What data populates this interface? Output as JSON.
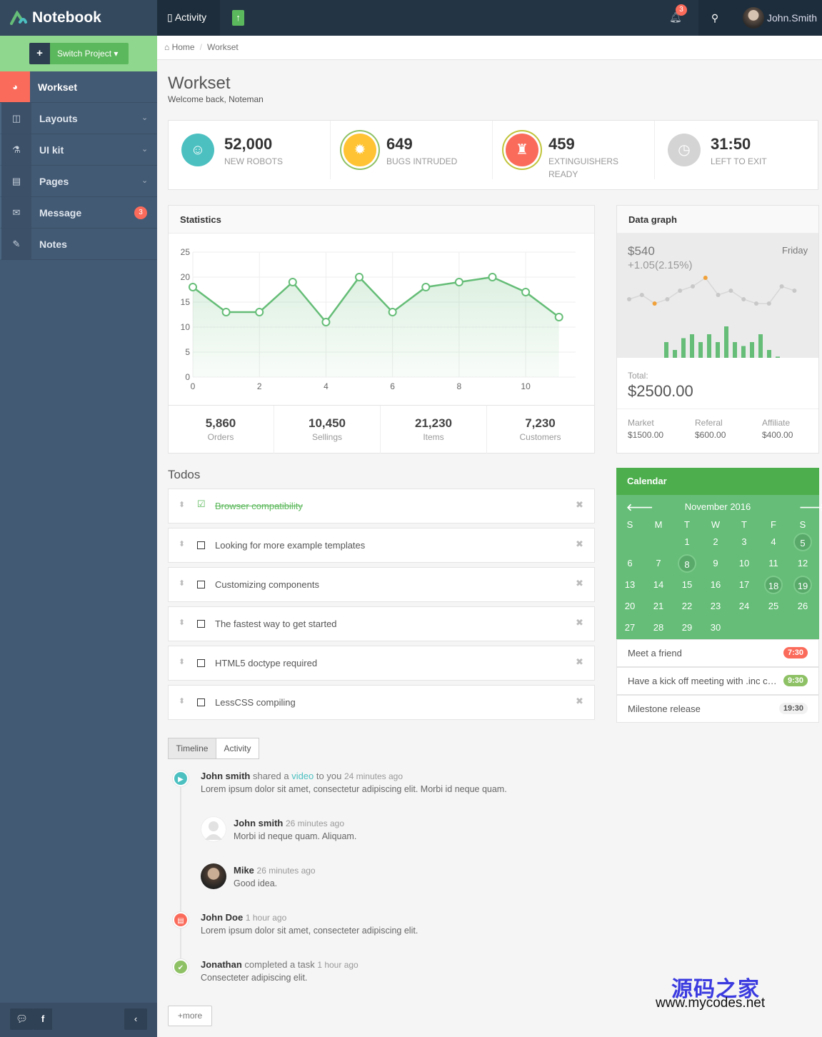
{
  "brand": {
    "name": "Notebook"
  },
  "header": {
    "activity_label": "Activity",
    "notifications_count": "3",
    "username": "John.Smith"
  },
  "sidebar": {
    "switch_project_label": "Switch Project ▾",
    "items": [
      {
        "label": "Workset",
        "icon": "dashboard-icon",
        "active": true
      },
      {
        "label": "Layouts",
        "icon": "columns-icon"
      },
      {
        "label": "UI kit",
        "icon": "flask-icon"
      },
      {
        "label": "Pages",
        "icon": "file-icon"
      },
      {
        "label": "Message",
        "icon": "envelope-icon",
        "badge": "3"
      },
      {
        "label": "Notes",
        "icon": "pencil-icon"
      }
    ]
  },
  "breadcrumb": {
    "home": "Home",
    "current": "Workset"
  },
  "page": {
    "title": "Workset",
    "subtitle": "Welcome back, Noteman"
  },
  "stats": [
    {
      "value": "52,000",
      "label": "NEW ROBOTS",
      "color": "#4cc0c1",
      "icon": "robot-icon"
    },
    {
      "value": "649",
      "label": "BUGS INTRUDED",
      "color": "#ffc333",
      "icon": "bug-icon"
    },
    {
      "value": "459",
      "label": "EXTINGUISHERS READY",
      "color": "#fb6b5b",
      "icon": "extinguisher-icon"
    },
    {
      "value": "31:50",
      "label": "LEFT TO EXIT",
      "color": "#d4d4d4",
      "icon": "clock-icon"
    }
  ],
  "statistics": {
    "title": "Statistics",
    "footer": [
      {
        "value": "5,860",
        "label": "Orders"
      },
      {
        "value": "10,450",
        "label": "Sellings"
      },
      {
        "value": "21,230",
        "label": "Items"
      },
      {
        "value": "7,230",
        "label": "Customers"
      }
    ]
  },
  "chart_data": {
    "type": "area",
    "x": [
      0,
      1,
      2,
      3,
      4,
      5,
      6,
      7,
      8,
      9,
      10,
      11
    ],
    "values": [
      18,
      13,
      13,
      19,
      11,
      20,
      13,
      18,
      19,
      20,
      17,
      12
    ],
    "xticks": [
      0,
      2,
      4,
      6,
      8,
      10
    ],
    "yticks": [
      0,
      5,
      10,
      15,
      20,
      25
    ],
    "xlim": [
      0,
      11.5
    ],
    "ylim": [
      0,
      25
    ],
    "grid": true,
    "color": "#65bd77"
  },
  "data_graph": {
    "title": "Data graph",
    "value": "$540",
    "change": "+1.05(2.15%)",
    "day": "Friday",
    "line": [
      6,
      7,
      5,
      6,
      8,
      9,
      11,
      7,
      8,
      6,
      5,
      5,
      9,
      8
    ],
    "bars": [
      4,
      2,
      5,
      6,
      4,
      6,
      4,
      8,
      4,
      3,
      4,
      6,
      2,
      0.3
    ],
    "total_label": "Total:",
    "total": "$2500.00",
    "breakdown": [
      {
        "label": "Market",
        "value": "$1500.00"
      },
      {
        "label": "Referal",
        "value": "$600.00"
      },
      {
        "label": "Affiliate",
        "value": "$400.00"
      }
    ]
  },
  "todos": {
    "title": "Todos",
    "items": [
      {
        "text": "Browser compatibility",
        "done": true
      },
      {
        "text": "Looking for more example templates",
        "done": false
      },
      {
        "text": "Customizing components",
        "done": false
      },
      {
        "text": "The fastest way to get started",
        "done": false
      },
      {
        "text": "HTML5 doctype required",
        "done": false
      },
      {
        "text": "LessCSS compiling",
        "done": false
      }
    ]
  },
  "calendar": {
    "title": "Calendar",
    "month": "November 2016",
    "weekdays": [
      "S",
      "M",
      "T",
      "W",
      "T",
      "F",
      "S"
    ],
    "first_weekday": 2,
    "days": 30,
    "event_days": [
      5,
      8,
      18,
      19
    ],
    "events": [
      {
        "text": "Meet a friend",
        "time": "7:30",
        "color": "#fb6b5b"
      },
      {
        "text": "Have a kick off meeting with .inc company",
        "time": "9:30",
        "color": "#8ec165"
      },
      {
        "text": "Milestone release",
        "time": "19:30",
        "color": "#f1f1f1"
      }
    ]
  },
  "timeline": {
    "tabs": [
      "Timeline",
      "Activity"
    ],
    "entries": [
      {
        "name": "John smith",
        "action": "shared a",
        "link": "video",
        "action2": "to you",
        "time": "24 minutes ago",
        "body": "Lorem ipsum dolor sit amet, consectetur adipiscing elit. Morbi id neque quam."
      },
      {
        "name": "John smith",
        "time": "26 minutes ago",
        "body": "Morbi id neque quam. Aliquam."
      },
      {
        "name": "Mike",
        "time": "26 minutes ago",
        "body": "Good idea."
      },
      {
        "name": "John Doe",
        "time": "1 hour ago",
        "body": "Lorem ipsum dolor sit amet, consecteter adipiscing elit."
      },
      {
        "name": "Jonathan",
        "action": "completed a task",
        "time": "1 hour ago",
        "body": "Consecteter adipiscing elit."
      }
    ],
    "more_label": "more"
  },
  "watermark": {
    "cn": "源码之家",
    "url": "www.mycodes.net"
  }
}
